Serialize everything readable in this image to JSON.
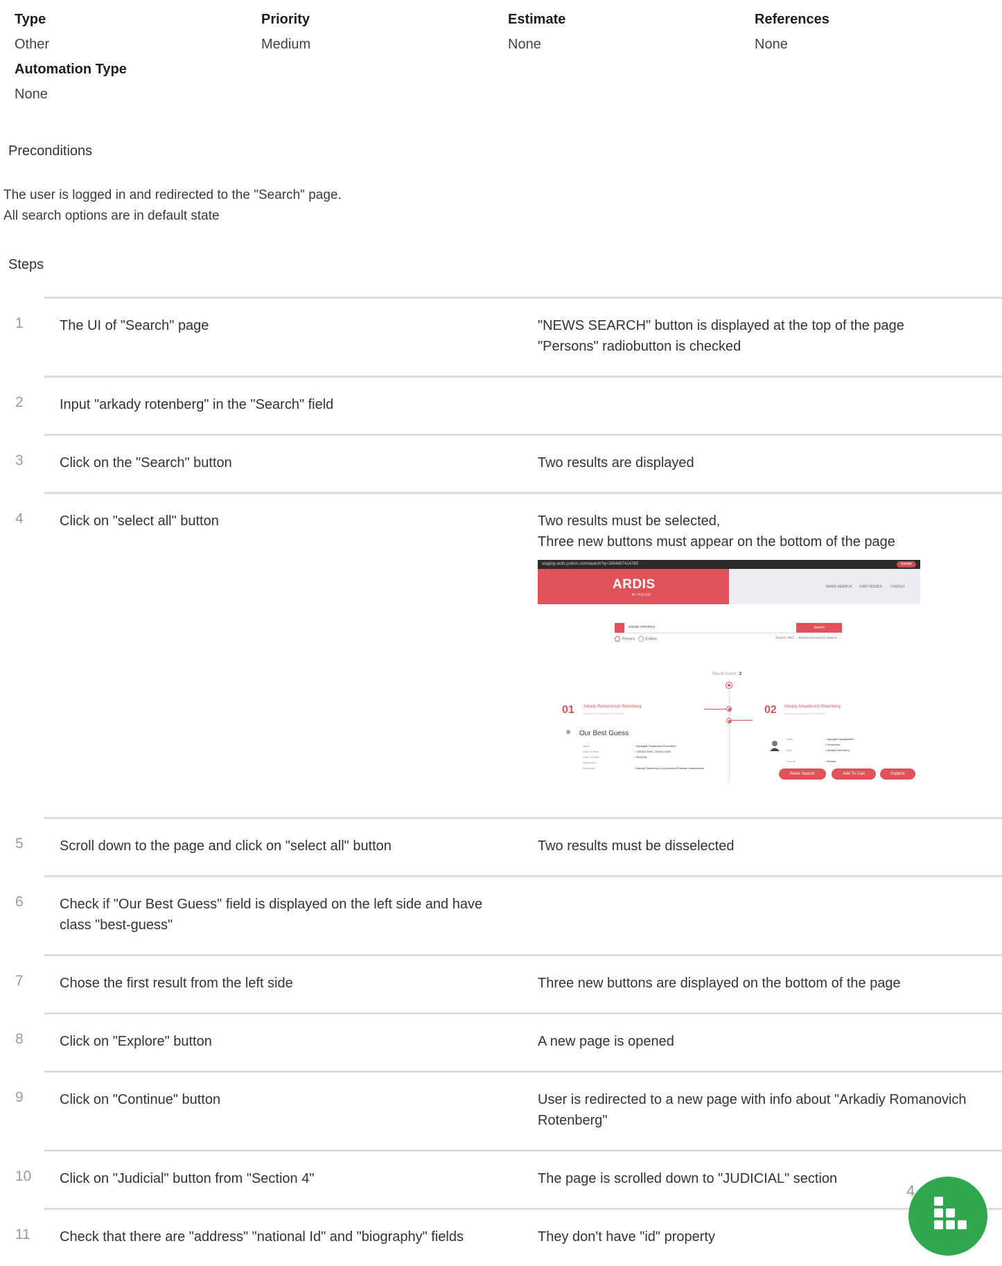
{
  "meta": {
    "type_label": "Type",
    "type_value": "Other",
    "priority_label": "Priority",
    "priority_value": "Medium",
    "estimate_label": "Estimate",
    "estimate_value": "None",
    "references_label": "References",
    "references_value": "None",
    "automation_label": "Automation Type",
    "automation_value": "None"
  },
  "preconditions": {
    "title": "Preconditions",
    "line1": "The user is logged in and redirected to the \"Search\" page.",
    "line2": "All search options are in default state"
  },
  "steps_title": "Steps",
  "steps": [
    {
      "num": "1",
      "action": "The UI of \"Search\" page",
      "result": "\"NEWS SEARCH\" button is displayed at the top of the page\n\"Persons\" radiobutton is checked"
    },
    {
      "num": "2",
      "action": "Input \"arkady rotenberg\" in the \"Search\" field",
      "result": ""
    },
    {
      "num": "3",
      "action": "Click on the \"Search\" button",
      "result": "Two results are displayed"
    },
    {
      "num": "4",
      "action": "Click on \"select all\" button",
      "result": "Two results must be selected,\nThree new buttons must appear on the bottom of the page"
    },
    {
      "num": "5",
      "action": "Scroll down to the page and click on \"select all\" button",
      "result": "Two results must be disselected"
    },
    {
      "num": "6",
      "action": "Check if \"Our Best Guess\" field is displayed on the left side and have class \"best-guess\"",
      "result": ""
    },
    {
      "num": "7",
      "action": "Chose the first result from the left side",
      "result": "Three new buttons are displayed on the bottom of the page"
    },
    {
      "num": "8",
      "action": "Click on \"Explore\" button",
      "result": "A new page is opened"
    },
    {
      "num": "9",
      "action": "Click on \"Continue\" button",
      "result": "User is redirected to a new page with info about \"Arkadiy Romanovich Rotenberg\""
    },
    {
      "num": "10",
      "action": "Click on \"Judicial\" button from \"Section 4\"",
      "result": "The page is scrolled down to \"JUDICIAL\" section"
    },
    {
      "num": "11",
      "action": "Check that there are \"address\" \"national Id\" and \"biography\" fields",
      "result": "They don't have \"id\" property"
    }
  ],
  "screenshot": {
    "url": "staging-ardis.polisis.com/search?q=1654687414789",
    "update": "Update",
    "logo": "ARDIS",
    "logo_sub": "BY POLISIS",
    "nav": [
      "NEWS SEARCH",
      "CART NODES",
      "LOGOUT"
    ],
    "search_text": "arkady rotenberg",
    "search_btn": "Search",
    "radio_persons": "Persons",
    "radio_entities": "Entities",
    "opts": "Search filter ⌄    Advanced search options ⌄",
    "found_label": "Result found : ",
    "found_count": "2",
    "r1_num": "01",
    "r1_name": "Arkady Romanovich Rotenberg",
    "r1_sub": "Аркадий Романович Ротенберг",
    "r2_num": "02",
    "r2_name": "Arkady Arkadievich Rotenberg",
    "r2_sub": "Аркадий Аркадьевич Ротенберг",
    "guess": "Our Best Guess",
    "btn_news": "News Search",
    "btn_cart": "Add To Cart",
    "btn_explore": "Explore"
  },
  "page_number": "4",
  "colors": {
    "brand": "#e0525a",
    "fab": "#2fa84f"
  }
}
